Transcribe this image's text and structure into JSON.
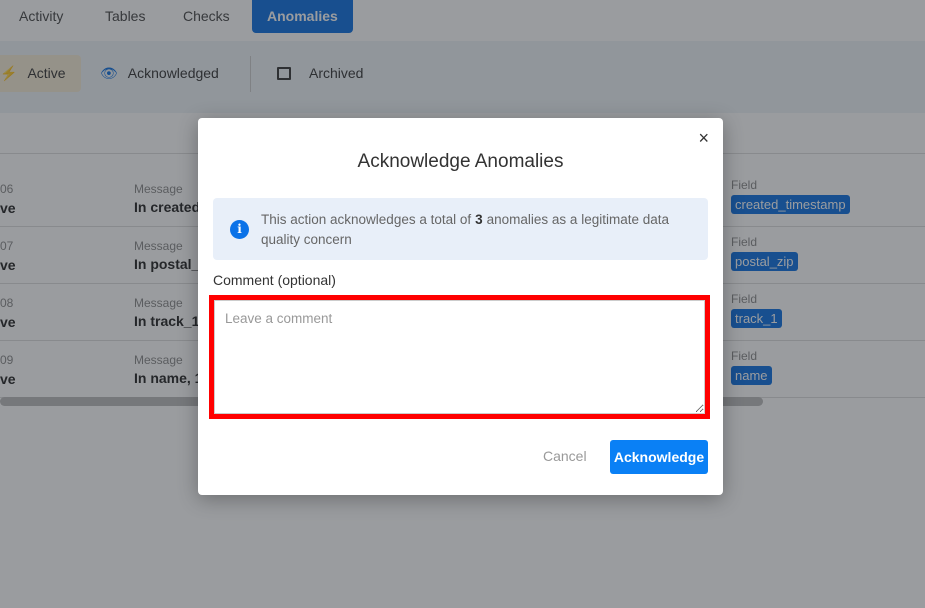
{
  "tabs": [
    {
      "label": "Activity"
    },
    {
      "label": "Tables"
    },
    {
      "label": "Checks"
    },
    {
      "label": "Anomalies",
      "active": true
    }
  ],
  "filters": {
    "active": "Active",
    "acknowledged": "Acknowledged",
    "archived": "Archived"
  },
  "rows": [
    {
      "id": "06",
      "status": "ve",
      "message_label": "Message",
      "message": "In created_",
      "field_label": "Field",
      "field": "created_timestamp"
    },
    {
      "id": "07",
      "status": "ve",
      "message_label": "Message",
      "message": "In postal_z",
      "field_label": "Field",
      "field": "postal_zip"
    },
    {
      "id": "08",
      "status": "ve",
      "message_label": "Message",
      "message": "In track_1,",
      "field_label": "Field",
      "field": "track_1"
    },
    {
      "id": "09",
      "status": "ve",
      "message_label": "Message",
      "message": "In name, 1.:",
      "field_label": "Field",
      "field": "name"
    }
  ],
  "modal": {
    "title": "Acknowledge Anomalies",
    "info_prefix": "This action acknowledges a total of",
    "count": "3",
    "info_suffix": "anomalies as a legitimate data quality concern",
    "comment_label": "Comment (optional)",
    "comment_placeholder": "Leave a comment",
    "comment_value": "",
    "cancel": "Cancel",
    "acknowledge": "Acknowledge",
    "close": "×"
  },
  "colors": {
    "accent": "#0a80f5",
    "highlight": "#ff0000",
    "field_badge": "#0a6ee0"
  }
}
